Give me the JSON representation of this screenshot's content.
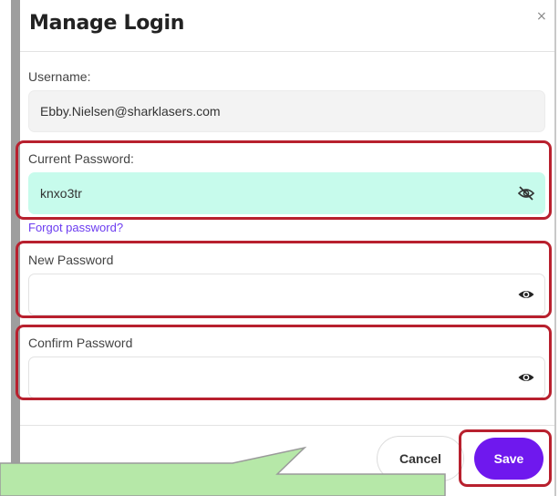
{
  "dialog": {
    "title": "Manage Login",
    "close_glyph": "×"
  },
  "username": {
    "label": "Username:",
    "value": "Ebby.Nielsen@sharklasers.com"
  },
  "current_password": {
    "label": "Current Password:",
    "value": "knxo3tr",
    "icon": "eye-slash-icon"
  },
  "forgot_link": "Forgot password?",
  "new_password": {
    "label": "New Password",
    "value": "",
    "icon": "eye-icon"
  },
  "confirm_password": {
    "label": "Confirm Password",
    "value": "",
    "icon": "eye-icon"
  },
  "buttons": {
    "cancel": "Cancel",
    "save": "Save"
  },
  "colors": {
    "accent": "#6f18ee",
    "highlight": "#b8202e",
    "filled_field": "#c7fbec",
    "link": "#6c3cf0",
    "callout": "#b6e8a8"
  }
}
